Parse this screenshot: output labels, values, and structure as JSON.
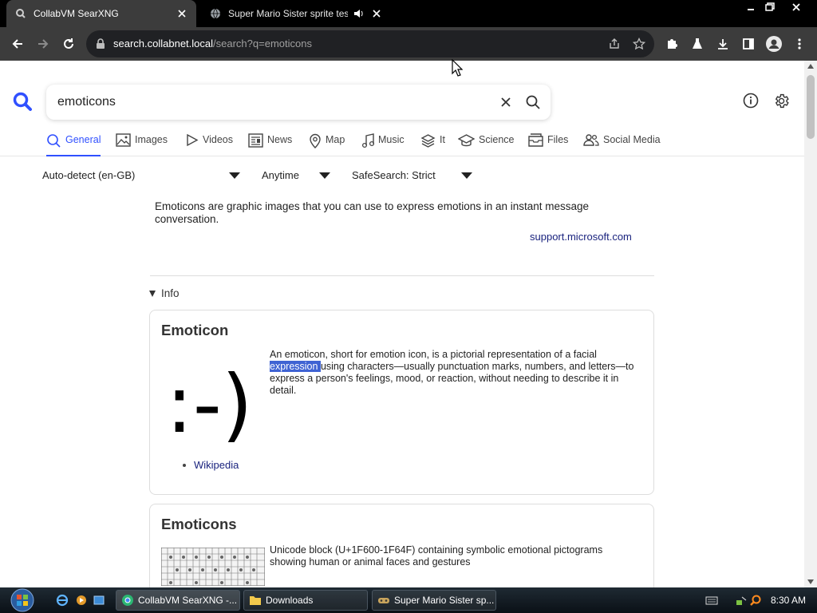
{
  "browser": {
    "tabs": [
      {
        "title": "CollabVM SearXNG",
        "active": true
      },
      {
        "title": "Super Mario Sister sprite test",
        "active": false
      }
    ],
    "url_host": "search.collabnet.local",
    "url_path": "/search?q=emoticons"
  },
  "search": {
    "query": "emoticons"
  },
  "categories": [
    {
      "label": "General",
      "icon": "search-icon",
      "active": true
    },
    {
      "label": "Images",
      "icon": "image-icon"
    },
    {
      "label": "Videos",
      "icon": "play-icon"
    },
    {
      "label": "News",
      "icon": "newspaper-icon"
    },
    {
      "label": "Map",
      "icon": "map-pin-icon"
    },
    {
      "label": "Music",
      "icon": "music-note-icon"
    },
    {
      "label": "It",
      "icon": "layers-icon"
    },
    {
      "label": "Science",
      "icon": "graduation-cap-icon"
    },
    {
      "label": "Files",
      "icon": "file-icon"
    },
    {
      "label": "Social Media",
      "icon": "people-icon"
    }
  ],
  "filters": {
    "language": "Auto-detect (en-GB)",
    "time": "Anytime",
    "safesearch": "SafeSearch: Strict"
  },
  "answer": {
    "text": "Emoticons are graphic images that you can use to express emotions in an instant message conversation.",
    "source": "support.microsoft.com"
  },
  "info_toggle": "Info",
  "infoboxes": [
    {
      "title": "Emoticon",
      "image_text": ":-)",
      "desc_before": "An emoticon, short for emotion icon, is a pictorial representation of a facial ",
      "desc_highlight": "expression ",
      "desc_after": "using characters—usually punctuation marks, numbers, and letters—to express a person's feelings, mood, or reaction, without needing to describe it in detail.",
      "link": "Wikipedia"
    },
    {
      "title": "Emoticons",
      "desc": "Unicode block (U+1F600-1F64F) containing symbolic emotional pictograms showing human or animal faces and gestures"
    }
  ],
  "taskbar": {
    "items": [
      {
        "label": "CollabVM SearXNG -...",
        "icon": "chrome-icon"
      },
      {
        "label": "Downloads",
        "icon": "folder-icon"
      },
      {
        "label": "Super Mario Sister sp...",
        "icon": "game-icon"
      }
    ],
    "clock": "8:30 AM"
  },
  "colors": {
    "accent": "#3050ff",
    "link": "#1a237e",
    "highlight": "#3f63d3"
  }
}
